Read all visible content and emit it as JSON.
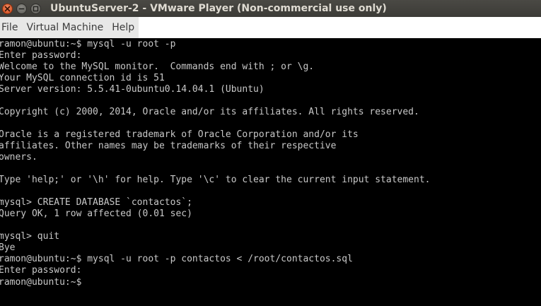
{
  "window": {
    "title": "UbuntuServer-2 - VMware Player (Non-commercial use only)"
  },
  "menu": {
    "items": [
      "File",
      "Virtual Machine",
      "Help"
    ]
  },
  "terminal": {
    "lines": [
      "ramon@ubuntu:~$ mysql -u root -p",
      "Enter password:",
      "Welcome to the MySQL monitor.  Commands end with ; or \\g.",
      "Your MySQL connection id is 51",
      "Server version: 5.5.41-0ubuntu0.14.04.1 (Ubuntu)",
      "",
      "Copyright (c) 2000, 2014, Oracle and/or its affiliates. All rights reserved.",
      "",
      "Oracle is a registered trademark of Oracle Corporation and/or its",
      "affiliates. Other names may be trademarks of their respective",
      "owners.",
      "",
      "Type 'help;' or '\\h' for help. Type '\\c' to clear the current input statement.",
      "",
      "mysql> CREATE DATABASE `contactos`;",
      "Query OK, 1 row affected (0.01 sec)",
      "",
      "mysql> quit",
      "Bye",
      "ramon@ubuntu:~$ mysql -u root -p contactos < /root/contactos.sql",
      "Enter password:",
      "ramon@ubuntu:~$"
    ]
  },
  "colors": {
    "titlebar": "#3c3b37",
    "title_text": "#dfdbd2",
    "close_button": "#e05b28",
    "menubar": "#e8e8e7",
    "terminal_bg": "#000000",
    "terminal_fg": "#c8c8c8"
  }
}
